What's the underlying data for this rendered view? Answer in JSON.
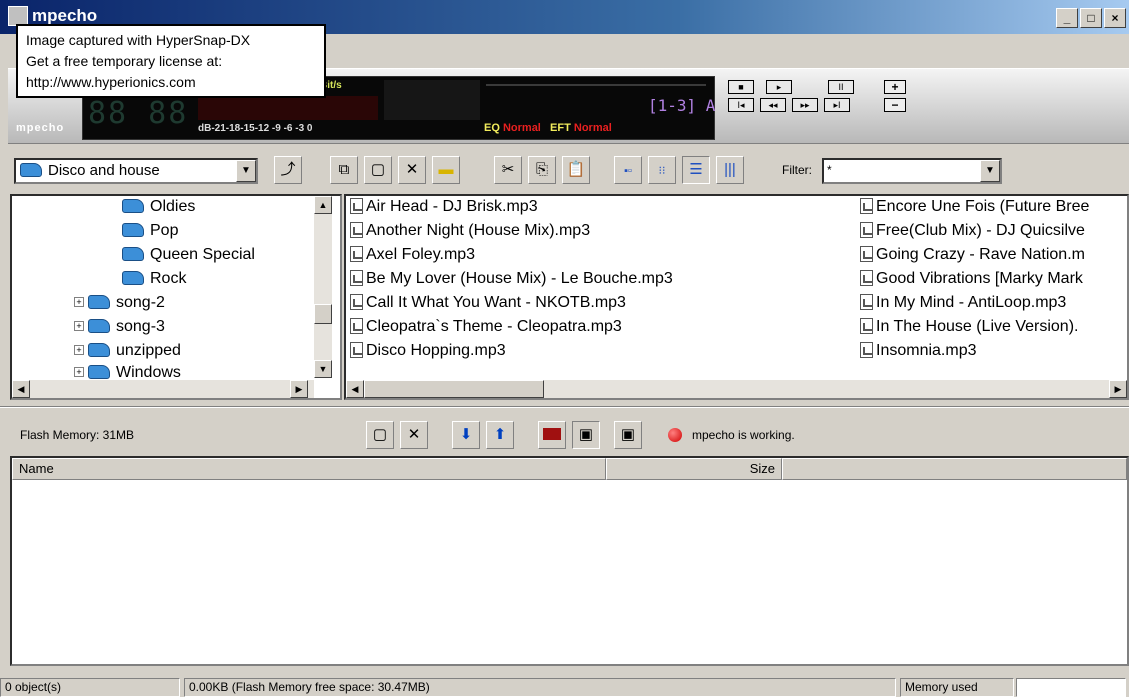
{
  "window": {
    "title": "mpecho",
    "min_label": "_",
    "max_label": "□",
    "close_label": "×"
  },
  "tooltip": {
    "line1": "Image captured with HyperSnap-DX",
    "line2": "Get a free temporary license at:",
    "line3": "http://www.hyperionics.com"
  },
  "player": {
    "brand": "mpecho",
    "time_digits": "88 88",
    "bitrate_label": "Bit/s",
    "db_scale": "dB-21-18-15-12 -9 -6 -3 0",
    "track_range": "[1-3] A",
    "eq_label": "EQ",
    "eq_value": "Normal",
    "eft_label": "EFT",
    "eft_value": "Normal",
    "transport": {
      "stop": "■",
      "play": "▸",
      "pause": "II",
      "prev": "I◂",
      "rewind": "◂◂",
      "forward": "▸▸",
      "next": "▸I"
    },
    "vol_up": "+",
    "vol_down": "−"
  },
  "toolbar": {
    "folder_selected": "Disco and house",
    "filter_label": "Filter:",
    "filter_value": "*"
  },
  "tree": {
    "items": [
      {
        "label": "Oldies",
        "expandable": false
      },
      {
        "label": "Pop",
        "expandable": false
      },
      {
        "label": "Queen Special",
        "expandable": false
      },
      {
        "label": "Rock",
        "expandable": false
      },
      {
        "label": "song-2",
        "expandable": true
      },
      {
        "label": "song-3",
        "expandable": true
      },
      {
        "label": "unzipped",
        "expandable": true
      },
      {
        "label": "Windows",
        "expandable": true
      }
    ]
  },
  "files": {
    "column1": [
      "Air Head - DJ Brisk.mp3",
      "Another Night (House Mix).mp3",
      "Axel Foley.mp3",
      "Be My Lover (House Mix) - Le Bouche.mp3",
      "Call It What You Want - NKOTB.mp3",
      "Cleopatra`s Theme - Cleopatra.mp3",
      "Disco Hopping.mp3"
    ],
    "column2": [
      "Encore Une Fois (Future Bree",
      "Free(Club Mix) - DJ Quicsilve",
      "Going Crazy - Rave Nation.m",
      "Good Vibrations [Marky Mark",
      "In My Mind - AntiLoop.mp3",
      "In The House (Live Version).",
      "Insomnia.mp3"
    ]
  },
  "flash": {
    "label": "Flash Memory: 31MB",
    "status": "mpecho is working.",
    "columns": [
      "Name",
      "Size"
    ]
  },
  "statusbar": {
    "objects": "0 object(s)",
    "free_space": "0.00KB (Flash Memory free space: 30.47MB)",
    "memory_used": "Memory used"
  },
  "colors": {
    "titlebar_start": "#0a246a",
    "folder_icon": "#3c8fd8",
    "status_dot": "#d00000",
    "lcd_background": "#080808"
  }
}
